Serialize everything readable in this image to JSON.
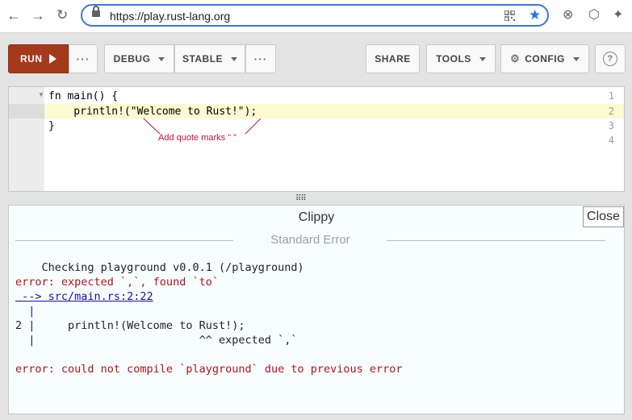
{
  "browser": {
    "url": "https://play.rust-lang.org"
  },
  "toolbar": {
    "run_label": "RUN",
    "more_dots": "···",
    "debug_label": "DEBUG",
    "stable_label": "STABLE",
    "share_label": "SHARE",
    "tools_label": "TOOLS",
    "config_label": "CONFIG",
    "help_label": "?"
  },
  "editor": {
    "line_numbers": [
      "1",
      "2",
      "3",
      "4"
    ],
    "lines": [
      "fn main() {",
      "    println!(\"Welcome to Rust!\");",
      "}",
      ""
    ],
    "annotation": "Add quote marks \" \""
  },
  "output": {
    "title": "Clippy",
    "close_label": "Close",
    "section_label": "Standard Error",
    "line1": "    Checking playground v0.0.1 (/playground)",
    "line2": "error: expected `,`, found `to`",
    "line3": " --> src/main.rs:2:22",
    "line4": "  |",
    "line5": "2 |     println!(Welcome to Rust!);",
    "line6": "  |                         ^^ expected `,`",
    "line7": "error: could not compile `playground` due to previous error"
  },
  "colors": {
    "run_button": "#a43a1b",
    "error_text": "#b2141a",
    "annotation": "#c8102e",
    "link": "#1a0dab"
  }
}
